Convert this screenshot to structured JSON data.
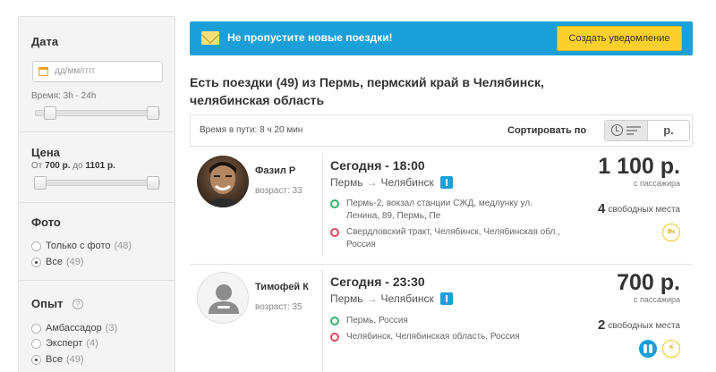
{
  "sidebar": {
    "date": {
      "title": "Дата",
      "placeholder": "дд/мм/гггг",
      "time_label": "Время: 3h - 24h"
    },
    "price": {
      "title": "Цена",
      "from_prefix": "От",
      "from_value": "700 р.",
      "to_prefix": "до",
      "to_value": "1101 р."
    },
    "photo": {
      "title": "Фото",
      "options": [
        {
          "label": "Только с фото",
          "count": "(48)"
        },
        {
          "label": "Все",
          "count": "(49)"
        }
      ]
    },
    "experience": {
      "title": "Опыт",
      "help_glyph": "?",
      "options": [
        {
          "label": "Амбассадор",
          "count": "(3)"
        },
        {
          "label": "Эксперт",
          "count": "(4)"
        },
        {
          "label": "Все",
          "count": "(49)"
        }
      ]
    }
  },
  "banner": {
    "text": "Не пропустите новые поездки!",
    "button": "Создать уведомление"
  },
  "results": {
    "heading": "Есть поездки (49) из Пермь, пермский край в Челябинск, челябинская область",
    "duration": "Время в пути: 8 ч 20 мин",
    "sort_label": "Сортировать по",
    "sort_price": "р."
  },
  "trips": [
    {
      "driver": "Фазил Р",
      "age": "возраст: 33",
      "time": "Сегодня - 18:00",
      "from": "Пермь",
      "arrow": "→",
      "to": "Челябинск",
      "pickup": "Пермь-2, вокзал станции СЖД, медлунку ул. Ленина, 89, Пермь, Пе",
      "dropoff": "Свердловский тракт, Челябинск, Челябинская обл., Россия",
      "price": "1 100 р.",
      "per": "с пассажира",
      "seats_count": "4",
      "seats_label": "свободных места",
      "badge": "8ч"
    },
    {
      "driver": "Тимофей К",
      "age": "возраст: 35",
      "time": "Сегодня - 23:30",
      "from": "Пермь",
      "arrow": "→",
      "to": "Челябинск",
      "pickup": "Пермь, Россия",
      "dropoff": "Челябинск, Челябинская область, Россия",
      "price": "700 р.",
      "per": "с пассажира",
      "seats_count": "2",
      "seats_label": "свободных места"
    }
  ],
  "colors": {
    "accent_blue": "#1a9fd8",
    "button_yellow": "#fcd02c",
    "pickup_green": "#36b36b",
    "dropoff_red": "#e0495e"
  }
}
